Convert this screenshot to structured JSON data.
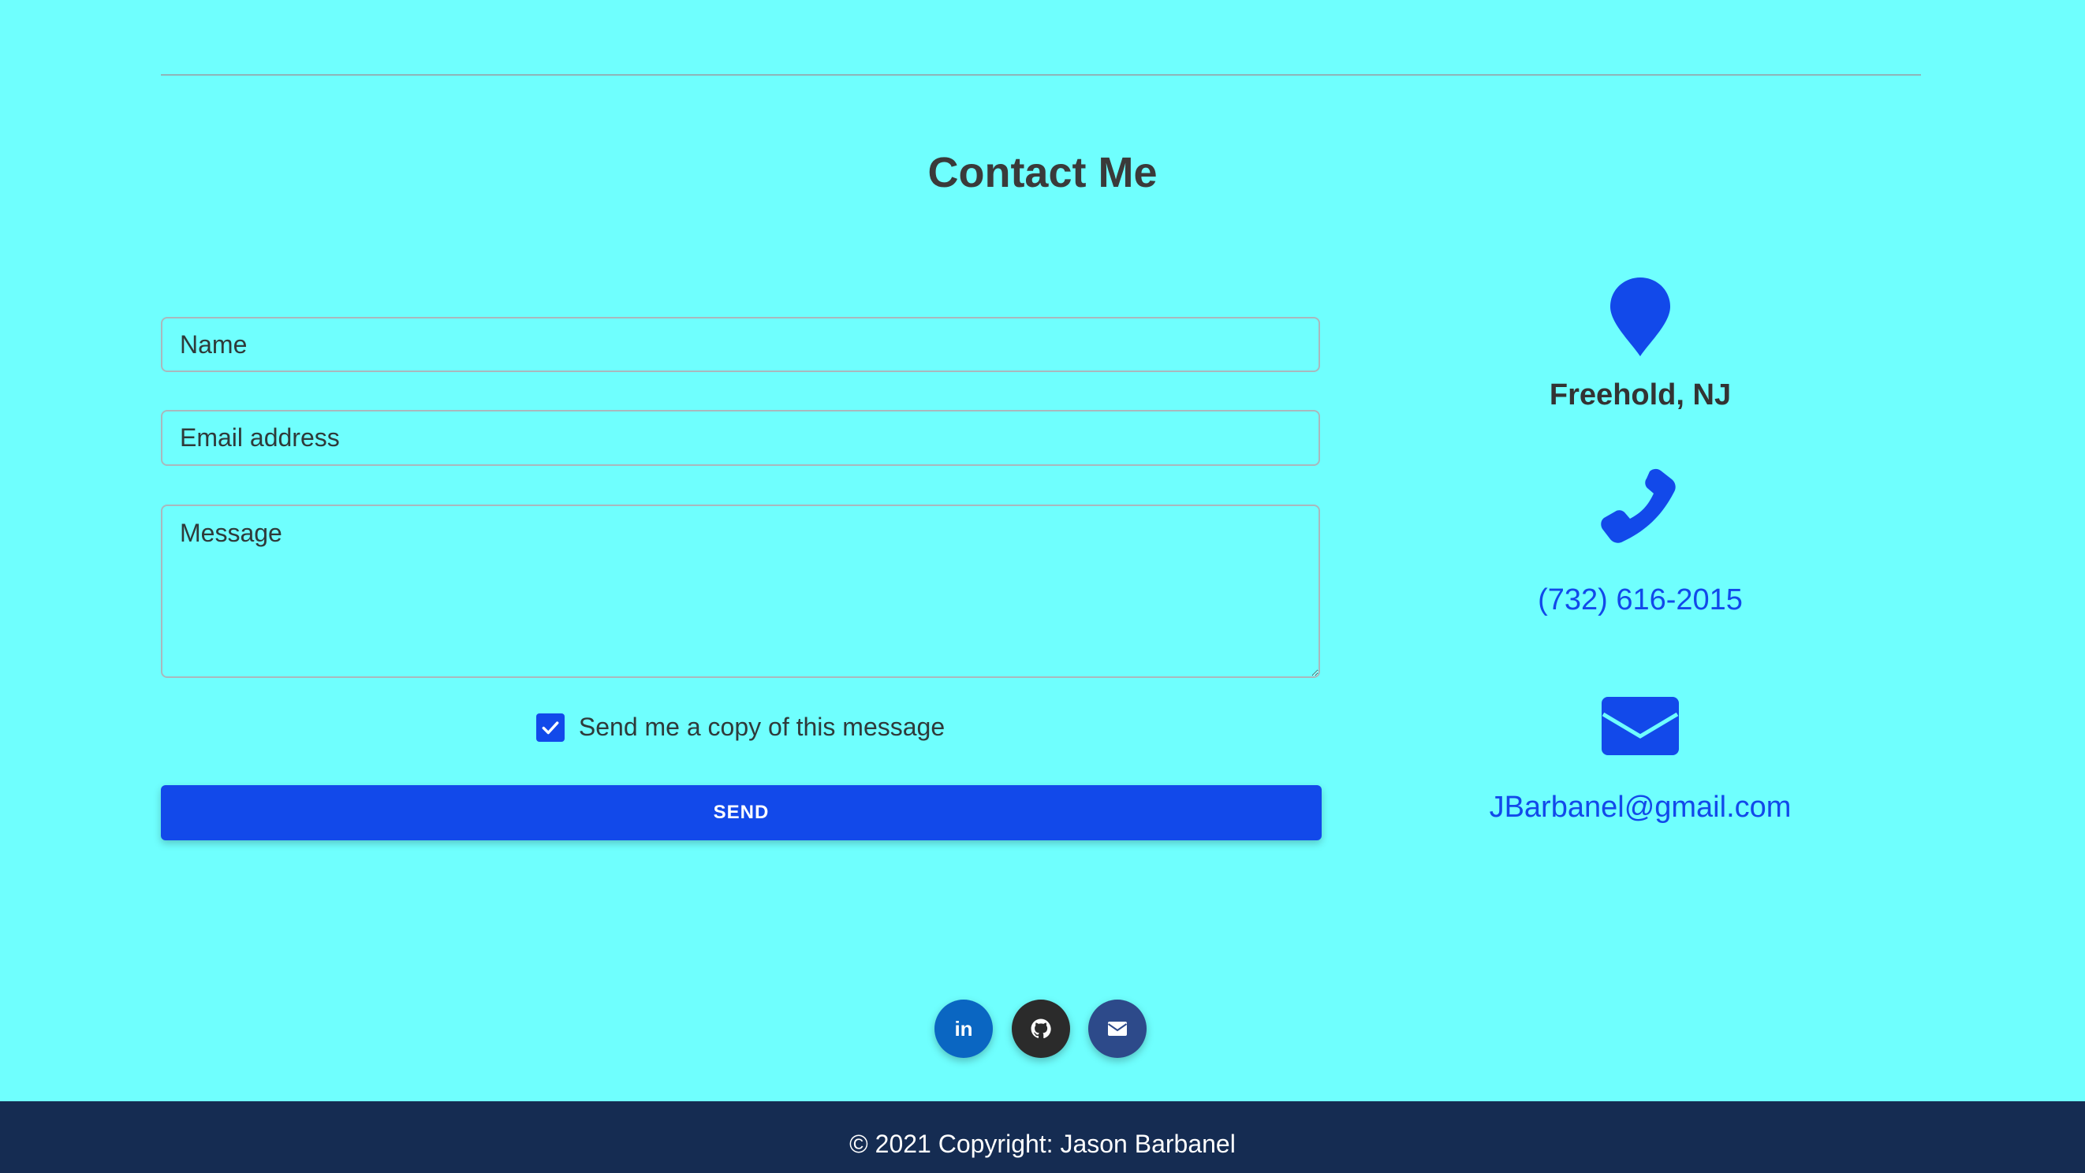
{
  "colors": {
    "background": "#6ffffe",
    "accent": "#1249ea",
    "footer": "#152c52",
    "linkedin": "#0a66c2",
    "github": "#2b2b2b",
    "mail": "#2d4a8a"
  },
  "contact": {
    "title": "Contact Me",
    "form": {
      "name_placeholder": "Name",
      "email_placeholder": "Email address",
      "message_placeholder": "Message",
      "copy_label": "Send me a copy of this message",
      "copy_checked": true,
      "send_label": "SEND"
    },
    "info": {
      "location_icon": "map-marker-icon",
      "location": "Freehold, NJ",
      "phone_icon": "phone-icon",
      "phone": "(732) 616-2015",
      "email_icon": "envelope-icon",
      "email": "JBarbanel@gmail.com"
    }
  },
  "social": [
    {
      "icon": "linkedin-icon",
      "glyph": "in"
    },
    {
      "icon": "github-icon"
    },
    {
      "icon": "envelope-icon"
    }
  ],
  "footer": {
    "copyright": "© 2021 Copyright: Jason Barbanel"
  }
}
